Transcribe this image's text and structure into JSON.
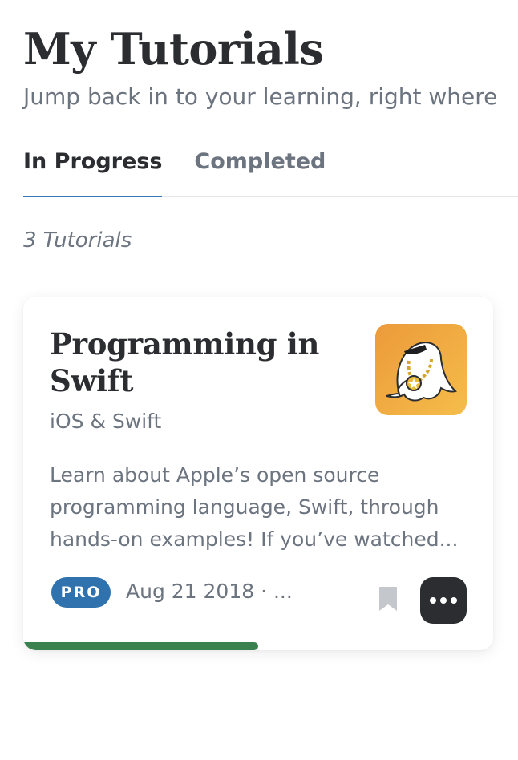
{
  "page": {
    "title": "My Tutorials",
    "subtitle": "Jump back in to your learning, right where"
  },
  "tabs": [
    {
      "label": "In Progress",
      "active": true
    },
    {
      "label": "Completed",
      "active": false
    }
  ],
  "list": {
    "count_label": "3 Tutorials"
  },
  "card": {
    "title": "Programming in Swift",
    "category": "iOS & Swift",
    "description": "Learn about Apple’s open source programming language, Swift, through hands-on examples! If you’ve watched...",
    "badge": "PRO",
    "meta": "Aug 21 2018 · ...",
    "progress": 0.5,
    "artwork_icon": "ghost-mascot-icon",
    "bookmark_icon": "bookmark-icon",
    "more_icon": "more-options-icon"
  },
  "colors": {
    "accent_blue": "#3478b5",
    "badge_blue": "#2f72ae",
    "progress_green": "#3a8150",
    "artwork_orange": "#f0a83a",
    "more_button_bg": "#2b2d31"
  }
}
